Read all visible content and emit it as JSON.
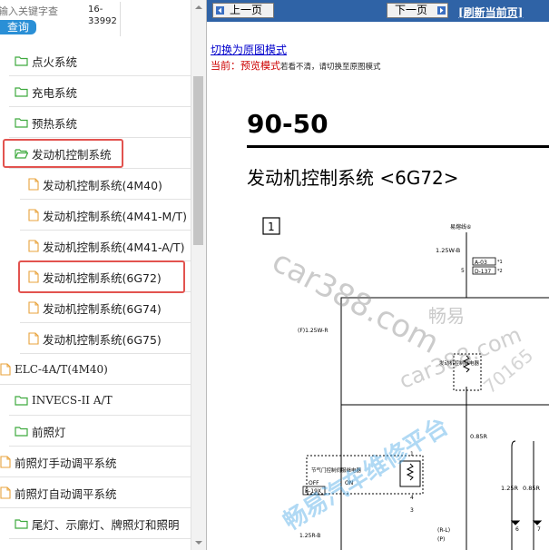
{
  "search": {
    "placeholder": "输入关键字查",
    "button_label": "查询",
    "result_id": "16-33992"
  },
  "tree": [
    {
      "label": "点火系统",
      "icon": "folder-icon",
      "level": 1
    },
    {
      "label": "充电系统",
      "icon": "folder-icon",
      "level": 1
    },
    {
      "label": "预热系统",
      "icon": "folder-icon",
      "level": 1
    },
    {
      "label": "发动机控制系统",
      "icon": "folder-open-icon",
      "level": 1,
      "selected": true
    },
    {
      "label": "发动机控制系统(4M40)",
      "icon": "document-icon",
      "level": 2
    },
    {
      "label": "发动机控制系统(4M41-M/T)",
      "icon": "document-icon",
      "level": 2
    },
    {
      "label": "发动机控制系统(4M41-A/T)",
      "icon": "document-icon",
      "level": 2
    },
    {
      "label": "发动机控制系统(6G72)",
      "icon": "document-icon",
      "level": 2,
      "selected": true
    },
    {
      "label": "发动机控制系统(6G74)",
      "icon": "document-icon",
      "level": 2
    },
    {
      "label": "发动机控制系统(6G75)",
      "icon": "document-icon",
      "level": 2
    },
    {
      "label": "ELC-4A/T(4M40)",
      "icon": "document-icon",
      "level": 0
    },
    {
      "label": "INVECS-II A/T",
      "icon": "folder-icon",
      "level": 1
    },
    {
      "label": "前照灯",
      "icon": "folder-icon",
      "level": 1
    },
    {
      "label": "前照灯手动调平系统",
      "icon": "document-icon",
      "level": 0
    },
    {
      "label": "前照灯自动调平系统",
      "icon": "document-icon",
      "level": 0
    },
    {
      "label": "尾灯、示廓灯、牌照灯和照明",
      "icon": "folder-icon",
      "level": 1
    }
  ],
  "viewer": {
    "prev_label": "上一页",
    "next_label": "下一页",
    "refresh_label": "[刷新当前页]",
    "mode_link": "切换为原图模式",
    "mode_current": "当前：预览模式",
    "mode_hint": "若看不清，请切换至原图模式",
    "page_number": "90-50",
    "page_title": "发动机控制系统 <6G72>"
  },
  "schematic": {
    "box_label": "1",
    "fusible_link": "易熔线⑥",
    "wire_125wb": "1.25W-B",
    "conn_a03": "A-03",
    "conn_d137": "D-137",
    "star1": "*1",
    "star2": "*2",
    "pin5": "5",
    "f_label": "(F)1.25W-R",
    "relay_text": "发动机控制继电器",
    "pin1": "1",
    "pin4": "4",
    "wire_085r": "0.85R",
    "switch_text": "节气门控制伺服继电器",
    "off_label": "OFF",
    "on_label": "ON",
    "b19x": "B-19X",
    "pin3": "3",
    "wire_125r": "1.25R",
    "wire_085r2": "0.85R",
    "wire_125rb": "1.25R-B",
    "rl_label": "(R-L)",
    "p_label": "(P)",
    "pin6": "6",
    "pin7": "7"
  },
  "watermarks": [
    "car388.com",
    "畅易",
    "car388.com",
    "畅易汽车维修平台",
    "70165"
  ],
  "colors": {
    "nav_bar": "#2f63a6",
    "folder": "#3faa3f",
    "document": "#e8a33c",
    "highlight": "#e2534f",
    "search_button": "#2a8fd6"
  }
}
